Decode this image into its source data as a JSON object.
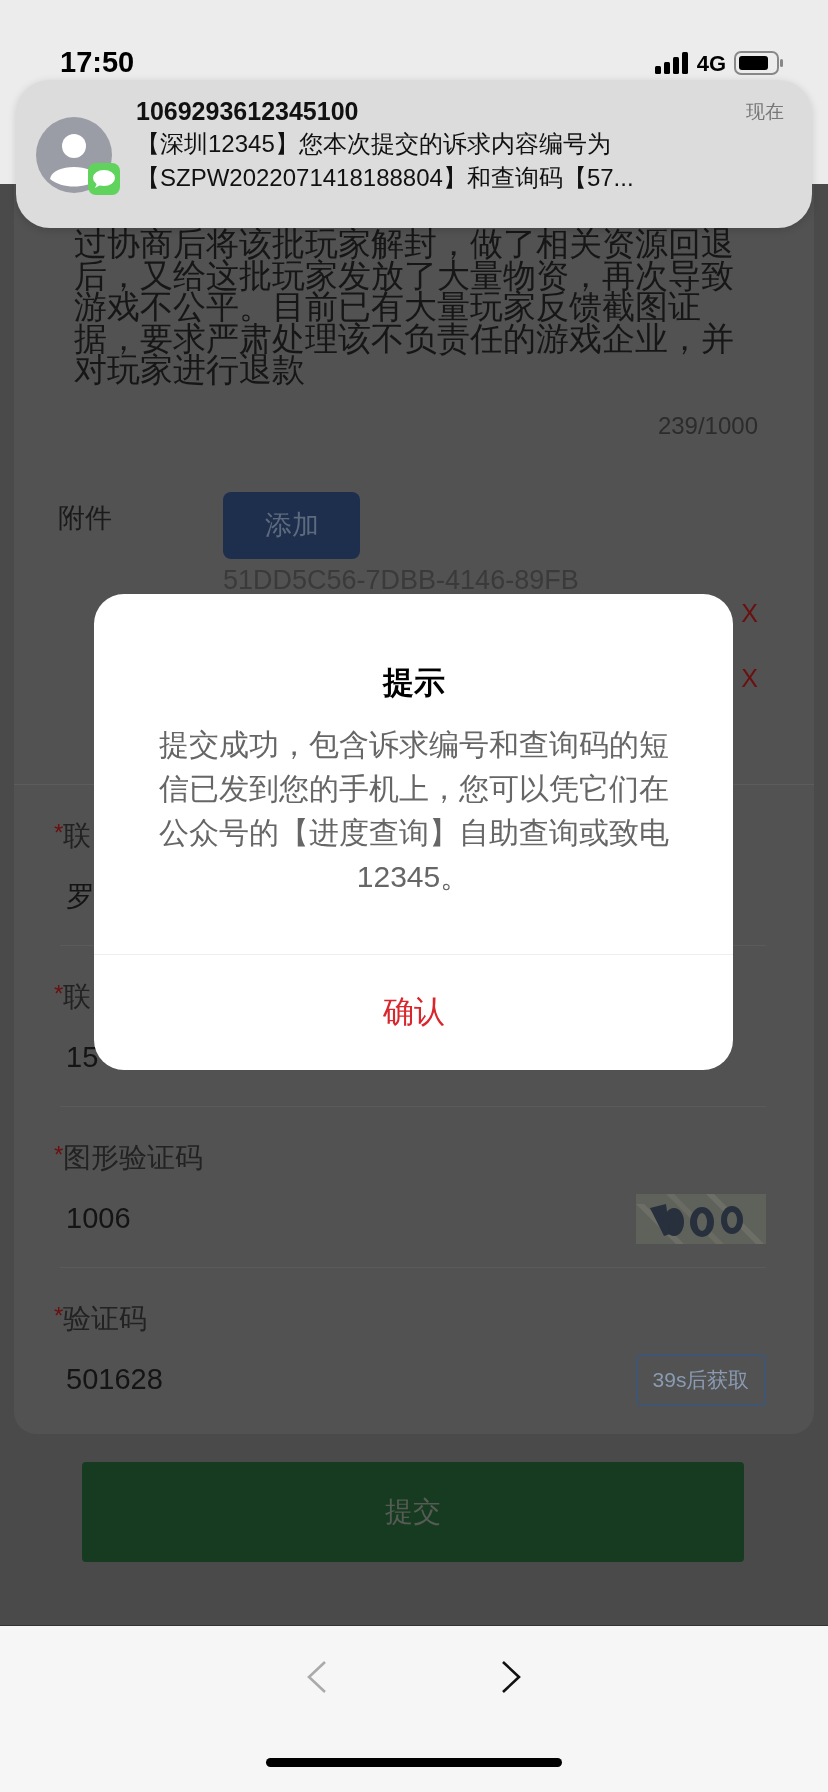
{
  "status_bar": {
    "time": "17:50",
    "network": "4G"
  },
  "notification": {
    "sender": "1069293612345100",
    "time": "现在",
    "message": "【深圳12345】您本次提交的诉求内容编号为【SZPW2022071418188804】和查询码【57..."
  },
  "form": {
    "description": "过协商后将该批玩家解封，做了相关资源回退后，又给这批玩家发放了大量物资，再次导致游戏不公平。目前已有大量玩家反馈截图证据，要求严肃处理该不负责任的游戏企业，并对玩家进行退款",
    "counter": "239/1000",
    "attachments": {
      "label": "附件",
      "add_button": "添加",
      "files": [
        {
          "name": "51DD5C56-7DBB-4146-89FB",
          "remove": "X"
        },
        {
          "remove": "X"
        }
      ]
    },
    "fields": [
      {
        "kind": "text",
        "required_mark": "*",
        "label": "联",
        "value": "罗"
      },
      {
        "kind": "text",
        "required_mark": "*",
        "label": "联",
        "value": "15"
      },
      {
        "kind": "captcha",
        "required_mark": "*",
        "label": "图形验证码",
        "value": "1006"
      },
      {
        "kind": "sms",
        "required_mark": "*",
        "label": "验证码",
        "value": "501628",
        "button": "39s后获取"
      }
    ],
    "submit": "提交"
  },
  "dialog": {
    "title": "提示",
    "message": "提交成功，包含诉求编号和查询码的短信已发到您的手机上，您可以凭它们在公众号的【进度查询】自助查询或致电12345。",
    "confirm": "确认"
  },
  "toolbar": {
    "back_enabled": false,
    "forward_enabled": true
  }
}
